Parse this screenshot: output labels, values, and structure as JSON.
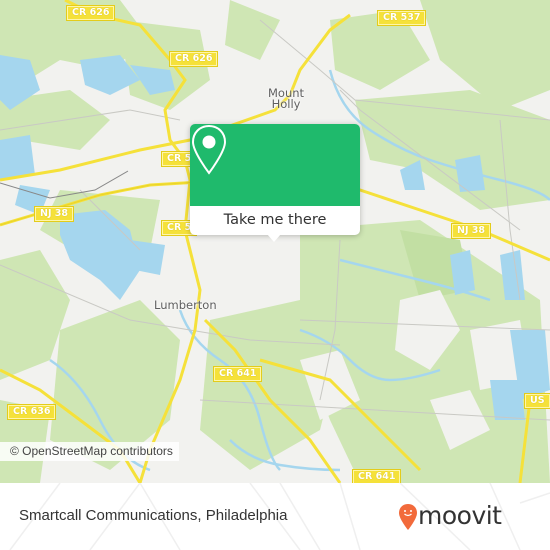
{
  "map": {
    "road_labels": [
      {
        "id": "cr626-top",
        "text": "CR 626"
      },
      {
        "id": "cr626-mid",
        "text": "CR 626"
      },
      {
        "id": "cr537",
        "text": "CR 537"
      },
      {
        "id": "cr5-upper",
        "text": "CR 5"
      },
      {
        "id": "nj38-left",
        "text": "NJ 38"
      },
      {
        "id": "cr5-lower",
        "text": "CR 5"
      },
      {
        "id": "nj38-right",
        "text": "NJ 38"
      },
      {
        "id": "cr641-mid",
        "text": "CR 641"
      },
      {
        "id": "cr636",
        "text": "CR 636"
      },
      {
        "id": "us-right",
        "text": "US"
      },
      {
        "id": "cr641-bottom",
        "text": "CR 641"
      }
    ],
    "place_labels": [
      {
        "id": "mount-holly",
        "text": "Mount\nHolly"
      },
      {
        "id": "lumberton",
        "text": "Lumberton"
      }
    ],
    "attribution": "© OpenStreetMap contributors",
    "colors": {
      "land": "#f2f2ef",
      "forest": "#cfe6b4",
      "water": "#a5d6ee",
      "road_major": "#f5e13a",
      "road_minor": "#c9c9c4"
    }
  },
  "popup": {
    "action_label": "Take me there",
    "icon": "map-pin-icon",
    "color": "#1fba6c"
  },
  "footer": {
    "place_name": "Smartcall Communications, Philadelphia",
    "brand": "moovit",
    "brand_icon": "moovit-smiley-pin-icon",
    "brand_color": "#f26a3b"
  }
}
